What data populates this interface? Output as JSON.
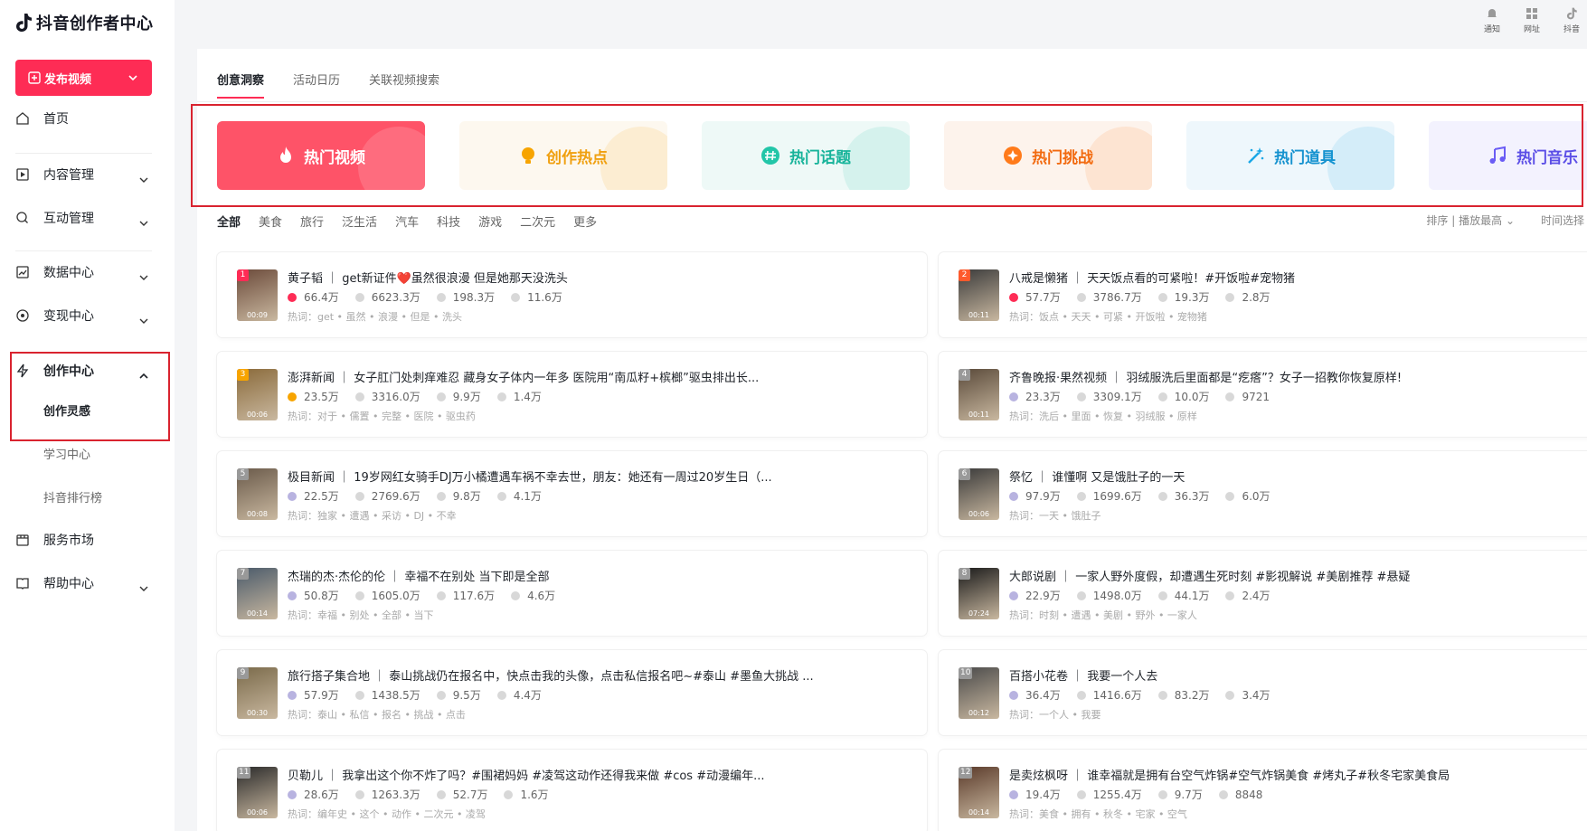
{
  "app": {
    "title": "抖音创作者中心",
    "publish_label": "发布视频"
  },
  "sidebar": {
    "home": "首页",
    "content": "内容管理",
    "interact": "互动管理",
    "data": "数据中心",
    "monetize": "变现中心",
    "create": "创作中心",
    "inspiration": "创作灵感",
    "learn": "学习中心",
    "rank": "抖音排行榜",
    "market": "服务市场",
    "help": "帮助中心"
  },
  "topbar": {
    "notify": "通知",
    "web": "网址",
    "douyin": "抖音"
  },
  "tabs": [
    "创意洞察",
    "活动日历",
    "关联视频搜索"
  ],
  "cards": [
    {
      "label": "热门视频",
      "color": "#fe2c55"
    },
    {
      "label": "创作热点",
      "color": "#f7a400"
    },
    {
      "label": "热门话题",
      "color": "#22c6a8"
    },
    {
      "label": "热门挑战",
      "color": "#ff7a1a"
    },
    {
      "label": "热门道具",
      "color": "#1aa7e6"
    },
    {
      "label": "热门音乐",
      "color": "#6a5cf5"
    }
  ],
  "filters": [
    "全部",
    "美食",
    "旅行",
    "泛生活",
    "汽车",
    "科技",
    "游戏",
    "二次元",
    "更多"
  ],
  "sort": {
    "label": "排序",
    "value": "播放最高",
    "time": "时间选择"
  },
  "videos": [
    {
      "rank": "1",
      "dur": "00:09",
      "title": "黄子韬 ｜ get新证件❤️虽然很浪漫 但是她那天没洗头",
      "s1": "66.4万",
      "s2": "6623.3万",
      "s3": "198.3万",
      "s4": "11.6万",
      "hot": "热词：get  •  虽然  •  浪漫  •  但是  •  洗头",
      "hotflag": true
    },
    {
      "rank": "2",
      "dur": "00:11",
      "title": "八戒是懒猪 ｜ 天天饭点看的可紧啦！#开饭啦#宠物猪",
      "s1": "57.7万",
      "s2": "3786.7万",
      "s3": "19.3万",
      "s4": "2.8万",
      "hot": "热词：饭点  •  天天  •  可紧  •  开饭啦  •  宠物猪",
      "hotflag": true
    },
    {
      "rank": "3",
      "dur": "00:06",
      "title": "澎湃新闻 ｜ 女子肛门处刺痒难忍 藏身女子体内一年多 医院用“南瓜籽+槟榔”驱虫排出长...",
      "s1": "23.5万",
      "s2": "3316.0万",
      "s3": "9.9万",
      "s4": "1.4万",
      "hot": "热词：对于  •  儒置  •  完整  •  医院  •  驱虫药",
      "hotflag": true
    },
    {
      "rank": "4",
      "dur": "00:11",
      "title": "齐鲁晚报·果然视频 ｜ 羽绒服洗后里面都是“疙瘩”？女子一招教你恢复原样!",
      "s1": "23.3万",
      "s2": "3309.1万",
      "s3": "10.0万",
      "s4": "9721",
      "hot": "热词：洗后  •  里面  •  恢复  •  羽绒服  •  原样",
      "hotflag": false
    },
    {
      "rank": "5",
      "dur": "00:08",
      "title": "极目新闻 ｜ 19岁网红女骑手DJ万小橘遭遇车祸不幸去世，朋友：她还有一周过20岁生日（...",
      "s1": "22.5万",
      "s2": "2769.6万",
      "s3": "9.8万",
      "s4": "4.1万",
      "hot": "热词：独家  •  遭遇  •  采访  •  DJ  •  不幸",
      "hotflag": false
    },
    {
      "rank": "6",
      "dur": "00:06",
      "title": "祭忆 ｜ 谁懂啊 又是饿肚子的一天",
      "s1": "97.9万",
      "s2": "1699.6万",
      "s3": "36.3万",
      "s4": "6.0万",
      "hot": "热词：一天  •  饿肚子",
      "hotflag": false
    },
    {
      "rank": "7",
      "dur": "00:14",
      "title": "杰瑞的杰·杰伦的伦 ｜ 幸福不在别处 当下即是全部",
      "s1": "50.8万",
      "s2": "1605.0万",
      "s3": "117.6万",
      "s4": "4.6万",
      "hot": "热词：幸福  •  别处  •  全部  •  当下",
      "hotflag": false
    },
    {
      "rank": "8",
      "dur": "07:24",
      "title": "大郎说剧 ｜ 一家人野外度假，却遭遇生死时刻 #影视解说 #美剧推荐 #悬疑",
      "s1": "22.9万",
      "s2": "1498.0万",
      "s3": "44.1万",
      "s4": "2.4万",
      "hot": "热词：时刻  •  遭遇  •  美剧  •  野外  •  一家人",
      "hotflag": false
    },
    {
      "rank": "9",
      "dur": "00:30",
      "title": "旅行搭子集合地 ｜ 泰山挑战仍在报名中，快点击我的头像，点击私信报名吧~#泰山 #墨鱼大挑战 ...",
      "s1": "57.9万",
      "s2": "1438.5万",
      "s3": "9.5万",
      "s4": "4.4万",
      "hot": "热词：泰山  •  私信  •  报名  •  挑战  •  点击",
      "hotflag": false
    },
    {
      "rank": "10",
      "dur": "00:12",
      "title": "百搭小花卷 ｜ 我要一个人去",
      "s1": "36.4万",
      "s2": "1416.6万",
      "s3": "83.2万",
      "s4": "3.4万",
      "hot": "热词：一个人  •  我要",
      "hotflag": false
    },
    {
      "rank": "11",
      "dur": "00:06",
      "title": "贝勒儿 ｜ 我拿出这个你不炸了吗？#围裙妈妈 #凌驾这动作还得我来做 #cos #动漫编年...",
      "s1": "28.6万",
      "s2": "1263.3万",
      "s3": "52.7万",
      "s4": "1.6万",
      "hot": "热词：编年史  •  这个  •  动作  •  二次元  •  凌驾",
      "hotflag": false
    },
    {
      "rank": "12",
      "dur": "00:14",
      "title": "是卖炫枫呀 ｜ 谁幸福就是拥有台空气炸锅#空气炸锅美食 #烤丸子#秋冬宅家美食局",
      "s1": "19.4万",
      "s2": "1255.4万",
      "s3": "9.7万",
      "s4": "8848",
      "hot": "热词：美食  •  拥有  •  秋冬  •  宅家  •  空气",
      "hotflag": false
    }
  ]
}
